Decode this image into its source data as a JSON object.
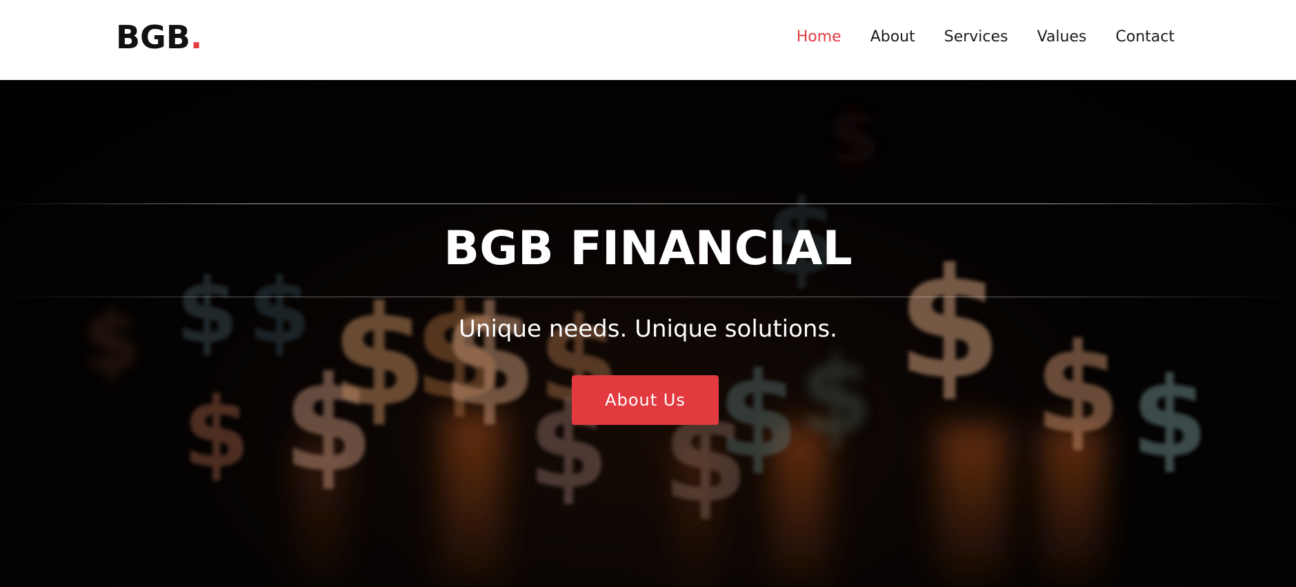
{
  "brand": {
    "logo_text": "BGB",
    "logo_dot": ".",
    "accent_color": "#e23a3f"
  },
  "nav": {
    "items": [
      {
        "label": "Home",
        "active": true
      },
      {
        "label": "About",
        "active": false
      },
      {
        "label": "Services",
        "active": false
      },
      {
        "label": "Values",
        "active": false
      },
      {
        "label": "Contact",
        "active": false
      }
    ]
  },
  "hero": {
    "title": "BGB FINANCIAL",
    "subtitle": "Unique needs. Unique solutions.",
    "cta_label": "About Us",
    "background": "blurred-dollar-signs-image"
  }
}
